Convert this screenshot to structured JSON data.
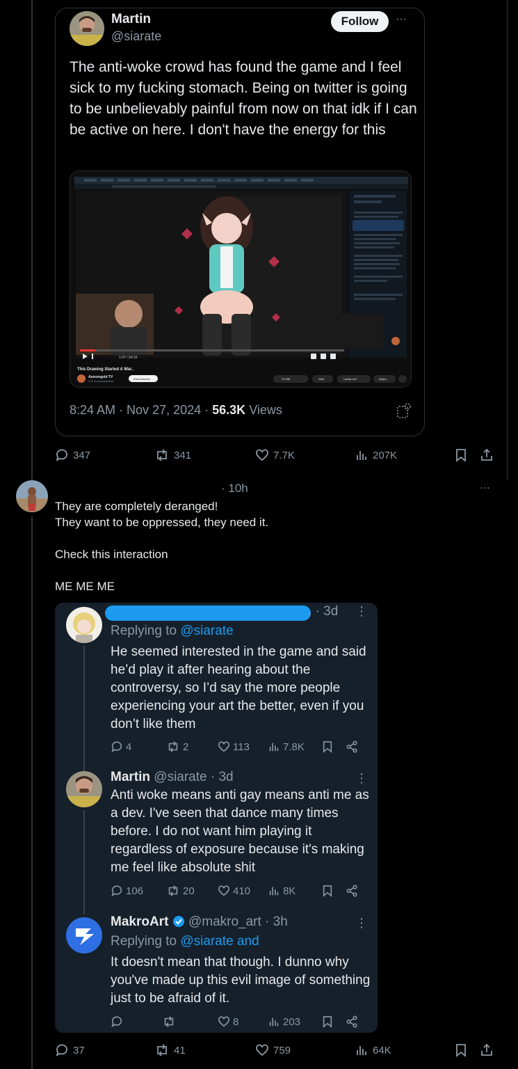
{
  "quoted_tweet": {
    "name": "Martin",
    "handle": "@siarate",
    "follow_label": "Follow",
    "more_label": "···",
    "text": "The anti-woke crowd has found the game and I feel sick to my fucking stomach. Being on twitter is going to be unbelievably painful from now on that idk if I can be active on here. I don't have the energy for this",
    "media": {
      "video_title": "This Drawing Started A War..",
      "channel": "Asmongold TV",
      "subs": "3,13 mn prenumeranter",
      "subscribe_label": "Prenumerera",
      "time": "1:37 / 24:15",
      "likes": "13 396",
      "share_label": "Dela",
      "download_label": "Ladda ned",
      "save_label": "Spara"
    },
    "timestamp": "8:24 AM · Nov 27, 2024 · ",
    "views_count": "56.3K",
    "views_label": "Views"
  },
  "quoted_actions": {
    "replies": "347",
    "reposts": "341",
    "likes": "7.7K",
    "views": "207K"
  },
  "post": {
    "time": "· 10h",
    "more_label": "···",
    "lines": [
      "They are completely deranged!",
      "They want to be oppressed, they need it.",
      "Check this interaction",
      "ME ME ME"
    ]
  },
  "screenshot": {
    "reply1": {
      "time": ". · 3d",
      "replying_prefix": "Replying to ",
      "replying_to": "@siarate",
      "text": "He seemed interested in the game and said he’d play it after hearing about the controversy, so I’d say the more people experiencing your art the better, even if you don’t like them",
      "replies": "4",
      "reposts": "2",
      "likes": "113",
      "views": "7.8K"
    },
    "reply2": {
      "name": "Martin",
      "handle": "@siarate · 3d",
      "text": "Anti woke means anti gay means anti me as a dev. I've seen that dance many times before. I do not want him playing it regardless of exposure because it's making me feel like absolute shit",
      "replies": "106",
      "reposts": "20",
      "likes": "410",
      "views": "8K"
    },
    "reply3": {
      "name": "MakroArt",
      "handle": "@makro_art · 3h",
      "replying_prefix": "Replying to ",
      "replying_to": "@siarate and",
      "text": "It doesn't mean that though. I dunno why you've made up this evil image of something just to be afraid of it.",
      "replies": "",
      "reposts": "",
      "likes": "8",
      "views": "203"
    }
  },
  "post_actions": {
    "replies": "37",
    "reposts": "41",
    "likes": "759",
    "views": "64K"
  },
  "colors": {
    "background": "#000000",
    "card": "#15202b",
    "accent": "#1d9bf0",
    "muted": "#8b98a5"
  }
}
